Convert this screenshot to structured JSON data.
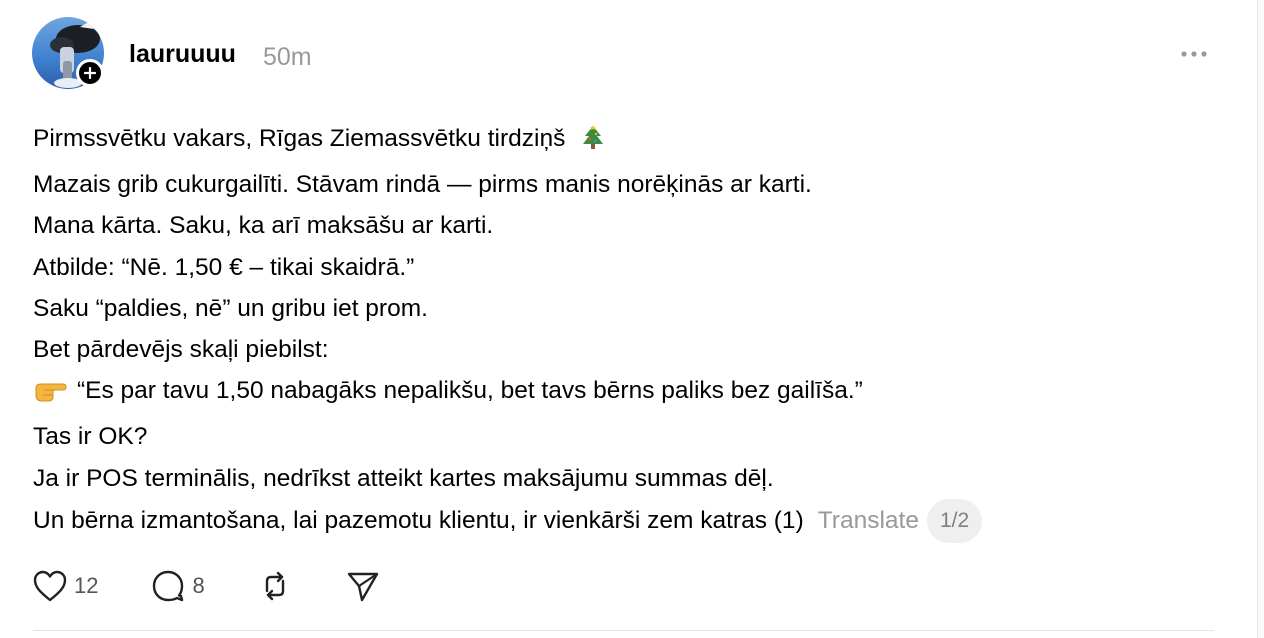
{
  "post": {
    "author": "lauruuuu",
    "time": "50m",
    "lines": [
      "Pirmssvētku vakars, Rīgas Ziemassvētku tirdziņš",
      "Mazais grib cukurgailīti. Stāvam rindā — pirms manis norēķinās ar karti.",
      "Mana kārta. Saku, ka arī maksāšu ar karti.",
      "Atbilde: “Nē. 1,50 € – tikai skaidrā.”",
      "Saku “paldies, nē” un gribu iet prom.",
      "Bet pārdevējs skaļi piebilst:",
      "“Es par tavu 1,50 nabagāks nepalikšu, bet tavs bērns paliks bez gailīša.”",
      "Tas ir OK?",
      "Ja ir POS terminālis, nedrīkst atteikt kartes maksājumu summas dēļ.",
      "Un bērna izmantošana, lai pazemotu klientu, ir vienkārši zem katras (1)"
    ],
    "translate_label": "Translate",
    "page_indicator": "1/2"
  },
  "actions": {
    "likes": "12",
    "comments": "8"
  },
  "icons": {
    "line1_emoji": "christmas-tree",
    "line7_emoji": "pointing-right-hand",
    "more": "more-dots",
    "like": "heart",
    "comment": "speech-bubble",
    "repost": "repost-arrows",
    "share": "paper-plane"
  }
}
